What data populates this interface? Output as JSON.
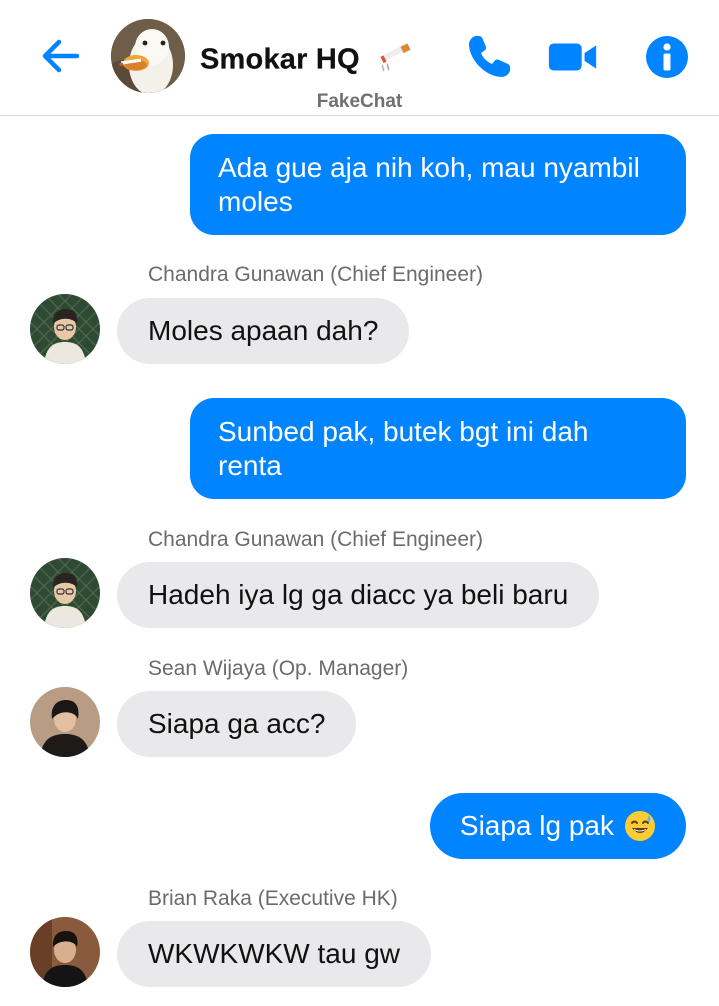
{
  "header": {
    "title": "Smokar HQ",
    "title_emoji": "🚬",
    "subtitle": "FakeChat",
    "back_icon": "arrow-left-icon",
    "call_icon": "phone-icon",
    "video_icon": "video-camera-icon",
    "info_icon": "info-icon",
    "accent_color": "#0084ff"
  },
  "messages": [
    {
      "direction": "out",
      "text_line1": "Ada gue aja nih koh, mau nyambil",
      "text_line2": "moles"
    },
    {
      "direction": "in",
      "sender": "Chandra Gunawan (Chief Engineer)",
      "text": "Moles apaan dah?"
    },
    {
      "direction": "out",
      "text_line1": "Sunbed pak, butek bgt ini dah",
      "text_line2": "renta"
    },
    {
      "direction": "in",
      "sender": "Chandra Gunawan (Chief Engineer)",
      "text": "Hadeh iya lg ga diacc ya beli baru"
    },
    {
      "direction": "in",
      "sender": "Sean Wijaya (Op. Manager)",
      "text": "Siapa ga acc?"
    },
    {
      "direction": "out",
      "text": "Siapa lg pak",
      "emoji": "😅"
    },
    {
      "direction": "in",
      "sender": "Brian Raka (Executive HK)",
      "text": "WKWKWKW tau gw"
    }
  ],
  "colors": {
    "outgoing_bubble": "#0084ff",
    "incoming_bubble": "#e9e9eb",
    "sender_label": "#6b6b6b"
  }
}
